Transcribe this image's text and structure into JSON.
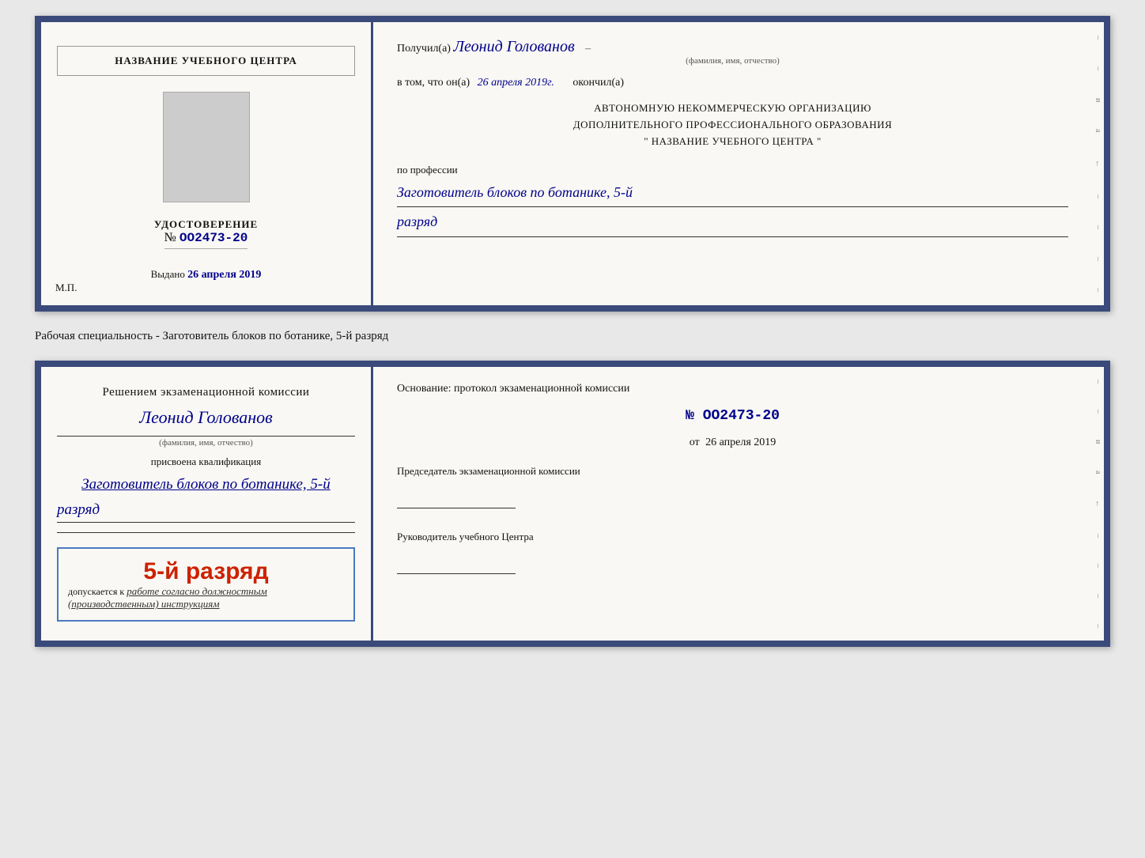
{
  "top_doc": {
    "left": {
      "title": "НАЗВАНИЕ УЧЕБНОГО ЦЕНТРА",
      "udostoverenie_label": "УДОСТОВЕРЕНИЕ",
      "number_prefix": "№",
      "number": "OO2473-20",
      "vydano_label": "Выдано",
      "vydano_date": "26 апреля 2019",
      "mp_label": "М.П."
    },
    "right": {
      "poluchil_prefix": "Получил(а)",
      "recipient_name": "Леонид Голованов",
      "name_sublabel": "(фамилия, имя, отчество)",
      "vtom_prefix": "в том, что он(а)",
      "vtom_date": "26 апреля 2019г.",
      "okончил": "окончил(а)",
      "org_line1": "АВТОНОМНУЮ НЕКОММЕРЧЕСКУЮ ОРГАНИЗАЦИЮ",
      "org_line2": "ДОПОЛНИТЕЛЬНОГО ПРОФЕССИОНАЛЬНОГО ОБРАЗОВАНИЯ",
      "org_name": "\" НАЗВАНИЕ УЧЕБНОГО ЦЕНТРА \"",
      "po_professii": "по профессии",
      "profession": "Заготовитель блоков по ботанике, 5-й",
      "razryad": "разряд"
    }
  },
  "middle_label": "Рабочая специальность - Заготовитель блоков по ботанике, 5-й разряд",
  "bottom_doc": {
    "left": {
      "resheniem": "Решением экзаменационной комиссии",
      "person_name": "Леонид Голованов",
      "name_sublabel": "(фамилия, имя, отчество)",
      "prisvoena": "присвоена квалификация",
      "kvalif": "Заготовитель блоков по ботанике, 5-й",
      "razryad": "разряд",
      "stamp_rank": "5-й разряд",
      "dopuskaetsya": "допускается к",
      "work_text": "работе согласно должностным",
      "instruktsii": "(производственным) инструкциям"
    },
    "right": {
      "osnovanie": "Основание: протокол экзаменационной комиссии",
      "number_prefix": "№",
      "number": "OO2473-20",
      "ot_prefix": "от",
      "date": "26 апреля 2019",
      "predsedatel_title": "Председатель экзаменационной комиссии",
      "rukovoditel_title": "Руководитель учебного Центра"
    }
  },
  "colors": {
    "border": "#3a4a7a",
    "name_blue": "#00008B",
    "stamp_red": "#cc2200",
    "stamp_border": "#4a7abf"
  }
}
